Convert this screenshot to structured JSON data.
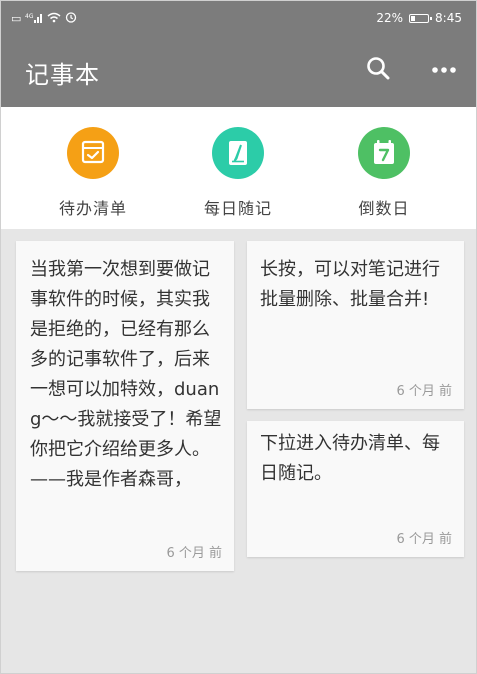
{
  "status_bar": {
    "left_indicators": "4G",
    "battery": "22%",
    "time": "8:45"
  },
  "app_bar": {
    "title": "记事本",
    "search_icon": "search-icon",
    "more_icon": "more-dots-icon"
  },
  "categories": [
    {
      "label": "待办清单",
      "icon": "todo-list-icon",
      "color": "#f5a015"
    },
    {
      "label": "每日随记",
      "icon": "daily-note-icon",
      "color": "#2ccca8"
    },
    {
      "label": "倒数日",
      "icon": "calendar-countdown-icon",
      "color": "#4ec064"
    }
  ],
  "notes": [
    {
      "text": "当我第一次想到要做记事软件的时候，其实我是拒绝的，已经有那么多的记事软件了，后来一想可以加特效，duang～～我就接受了！希望你把它介绍给更多人。——我是作者森哥，",
      "time": "6 个月 前"
    },
    {
      "text": "长按，可以对笔记进行批量删除、批量合并!",
      "time": "6 个月 前"
    },
    {
      "text": "下拉进入待办清单、每日随记。",
      "time": "6 个月 前"
    }
  ],
  "colors": {
    "app_bar": "#7c7c7c",
    "background": "#e6e6e6",
    "card": "#f9f9f9"
  }
}
